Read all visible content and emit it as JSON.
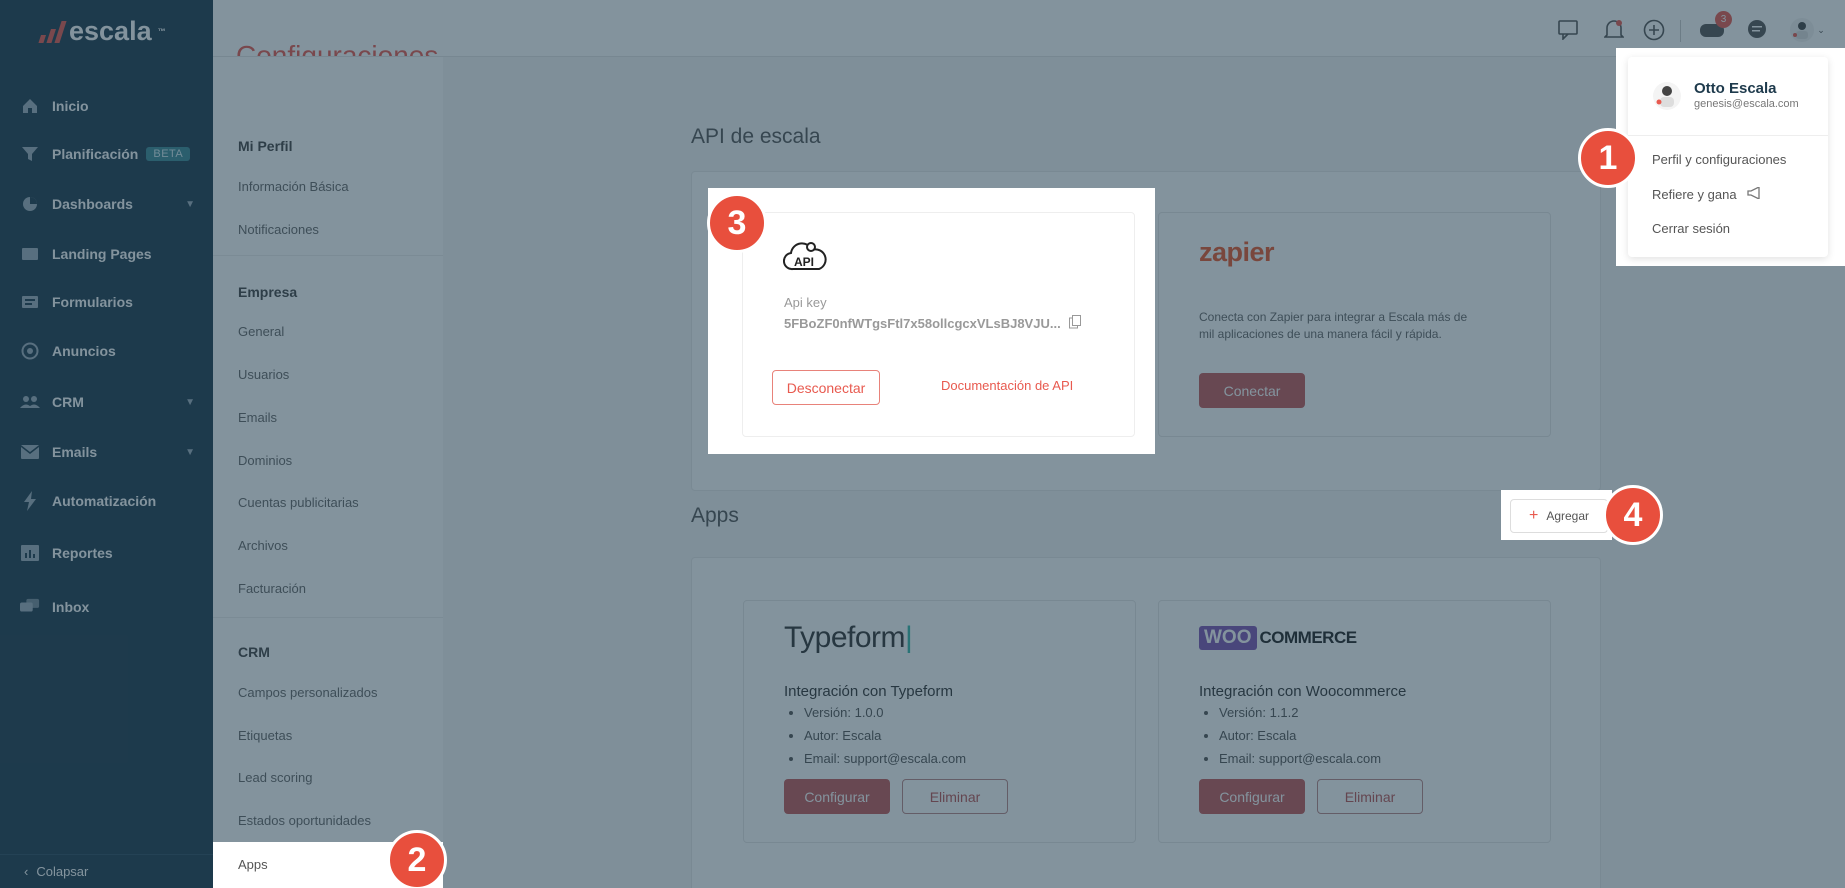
{
  "app": {
    "logo": "escala",
    "logo_mark": "™"
  },
  "sidebar": {
    "items": [
      {
        "label": "Inicio",
        "icon": "home-icon"
      },
      {
        "label": "Planificación",
        "icon": "filter-icon",
        "badge": "BETA"
      },
      {
        "label": "Dashboards",
        "icon": "pie-chart-icon"
      },
      {
        "label": "Landing Pages",
        "icon": "browser-icon"
      },
      {
        "label": "Formularios",
        "icon": "form-icon"
      },
      {
        "label": "Anuncios",
        "icon": "target-icon"
      },
      {
        "label": "CRM",
        "icon": "users-icon"
      },
      {
        "label": "Emails",
        "icon": "mail-icon"
      },
      {
        "label": "Automatización",
        "icon": "lightning-icon"
      },
      {
        "label": "Reportes",
        "icon": "chart-icon"
      },
      {
        "label": "Inbox",
        "icon": "chat-icon"
      }
    ],
    "collapse": "Colapsar"
  },
  "header": {
    "page_title": "Configuraciones",
    "notification_badge": "3"
  },
  "subnav": {
    "perfil": {
      "heading": "Mi Perfil",
      "items": [
        "Información Básica",
        "Notificaciones"
      ]
    },
    "empresa": {
      "heading": "Empresa",
      "items": [
        "General",
        "Usuarios",
        "Emails",
        "Dominios",
        "Cuentas publicitarias",
        "Archivos",
        "Facturación"
      ]
    },
    "crm": {
      "heading": "CRM",
      "items": [
        "Campos personalizados",
        "Etiquetas",
        "Lead scoring",
        "Estados oportunidades",
        "Apps"
      ]
    }
  },
  "api_section": {
    "title": "API de escala",
    "api_card": {
      "logo": "API",
      "key_label": "Api key",
      "key_value": "5FBoZF0nfWTgsFtl7x58ollcgcxVLsBJ8VJU...",
      "disconnect": "Desconectar",
      "docs": "Documentación de API"
    },
    "zapier_card": {
      "logo": "zapier",
      "description_line1": "Conecta con Zapier para integrar a Escala más de",
      "description_line2": "mil aplicaciones de una manera fácil y rápida.",
      "connect": "Conectar"
    }
  },
  "apps_section": {
    "title": "Apps",
    "add": "Agregar",
    "apps": [
      {
        "logo": "Typeform",
        "title": "Integración con Typeform",
        "version": "Versión: 1.0.0",
        "author": "Autor: Escala",
        "email": "Email: support@escala.com",
        "configure": "Configurar",
        "delete": "Eliminar"
      },
      {
        "logo_a": "WOO",
        "logo_b": "COMMERCE",
        "title": "Integración con Woocommerce",
        "version": "Versión: 1.1.2",
        "author": "Autor: Escala",
        "email": "Email: support@escala.com",
        "configure": "Configurar",
        "delete": "Eliminar"
      }
    ]
  },
  "user_menu": {
    "name": "Otto Escala",
    "email": "genesis@escala.com",
    "items": [
      "Perfil y configuraciones",
      "Refiere y gana",
      "Cerrar sesión"
    ]
  },
  "markers": [
    "1",
    "2",
    "3",
    "4"
  ],
  "colors": {
    "sidebar": "#1e3a4c",
    "accent": "#e85a4f",
    "marker": "#e84f3d"
  }
}
